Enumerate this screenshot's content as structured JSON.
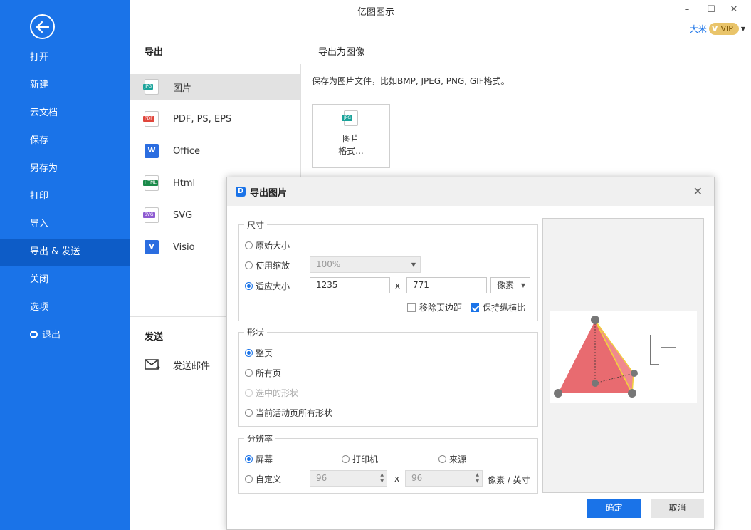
{
  "app": {
    "title": "亿图图示"
  },
  "window": {
    "minimize": "–",
    "maximize": "☐",
    "close": "✕"
  },
  "user": {
    "name": "大米",
    "vip": "VIP",
    "vip_mark": "V"
  },
  "sidebar": {
    "back_icon": "arrow-left-icon",
    "items": [
      {
        "label": "打开"
      },
      {
        "label": "新建"
      },
      {
        "label": "云文档"
      },
      {
        "label": "保存"
      },
      {
        "label": "另存为"
      },
      {
        "label": "打印"
      },
      {
        "label": "导入"
      },
      {
        "label": "导出 & 发送",
        "active": true
      },
      {
        "label": "关闭"
      },
      {
        "label": "选项"
      },
      {
        "label": "退出"
      }
    ]
  },
  "export": {
    "heading": "导出",
    "items": [
      {
        "label": "图片",
        "tag": "JPG",
        "tag_color": "#1aa39a"
      },
      {
        "label": "PDF, PS, EPS",
        "tag": "PDF",
        "tag_color": "#e0463c"
      },
      {
        "label": "Office",
        "tag": "W",
        "tag_color": "#2b6de0"
      },
      {
        "label": "Html",
        "tag": "HTML",
        "tag_color": "#1b8a4a"
      },
      {
        "label": "SVG",
        "tag": "SVG",
        "tag_color": "#8e5bd1"
      },
      {
        "label": "Visio",
        "tag": "V",
        "tag_color": "#2b6de0"
      }
    ]
  },
  "send": {
    "heading": "发送",
    "email_label": "发送邮件"
  },
  "export_image": {
    "heading": "导出为图像",
    "description": "保存为图片文件，比如BMP, JPEG, PNG, GIF格式。",
    "card_tag": "JPG",
    "card_line1": "图片",
    "card_line2": "格式..."
  },
  "dialog": {
    "title": "导出图片",
    "logo": "D",
    "close": "✕",
    "size": {
      "legend": "尺寸",
      "original": "原始大小",
      "use_zoom": "使用缩放",
      "zoom_value": "100%",
      "fit": "适应大小",
      "width": "1235",
      "x": "x",
      "height": "771",
      "unit": "像素",
      "remove_margin": "移除页边距",
      "keep_ratio": "保持纵横比",
      "selected": "fit"
    },
    "shape": {
      "legend": "形状",
      "whole_page": "整页",
      "all_pages": "所有页",
      "selected_shapes": "选中的形状",
      "current_page_shapes": "当前活动页所有形状",
      "selected": "whole_page"
    },
    "resolution": {
      "legend": "分辨率",
      "screen": "屏幕",
      "printer": "打印机",
      "source": "来源",
      "custom": "自定义",
      "dpi_x": "96",
      "x": "x",
      "dpi_y": "96",
      "unit": "像素 / 英寸",
      "selected": "screen"
    },
    "ok": "确定",
    "cancel": "取消"
  }
}
